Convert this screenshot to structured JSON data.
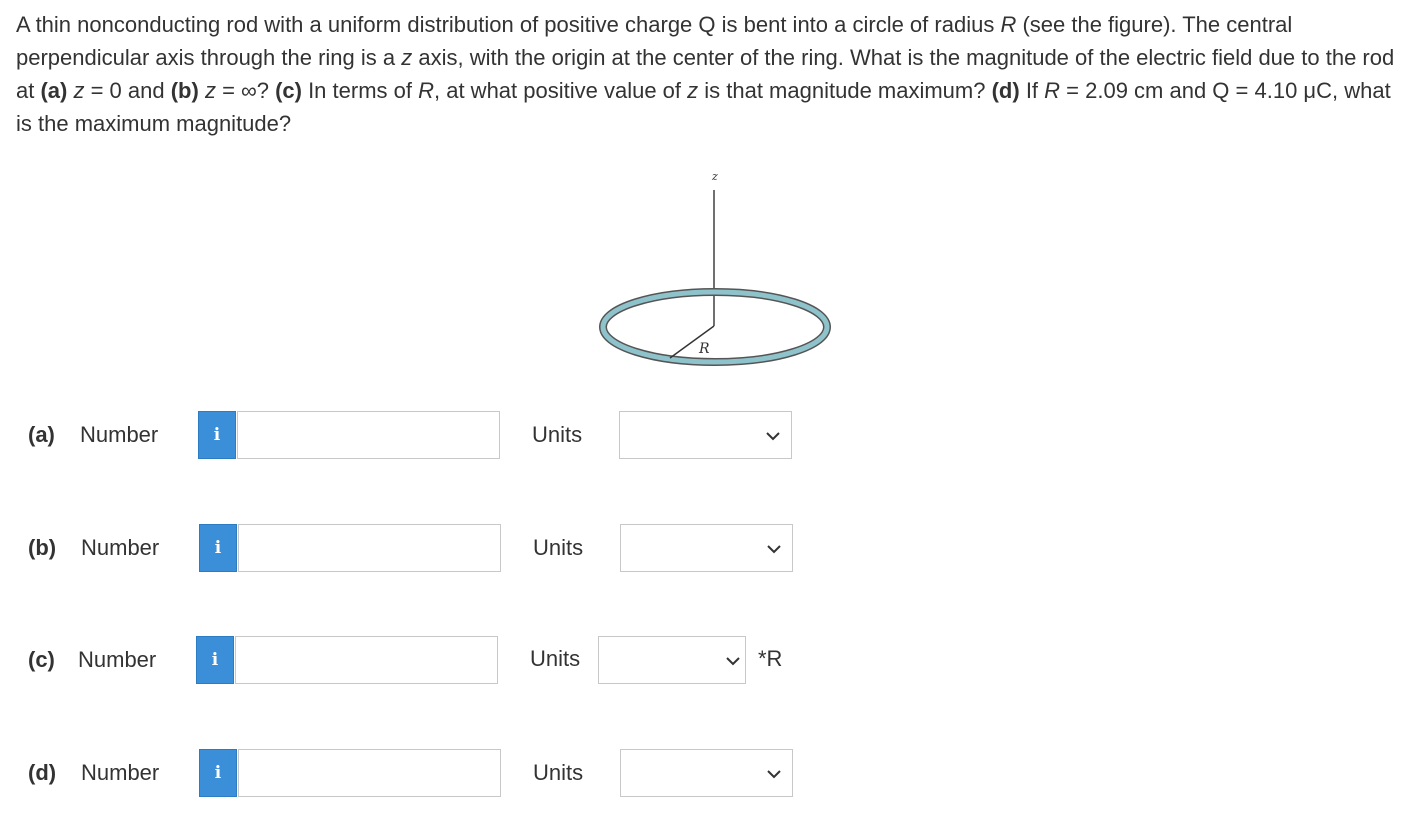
{
  "question": {
    "p1": "A thin nonconducting rod with a uniform distribution of positive charge Q is bent into a circle of radius ",
    "R1": "R",
    "p2": " (see the figure). The central perpendicular axis through the ring is a ",
    "z1": "z",
    "p3": " axis, with the origin at the center of the ring. What is the magnitude of the electric field due to the rod at ",
    "a": "(a)",
    "z2": "z",
    "p4": " = 0 and ",
    "b": "(b)",
    "z3": "z",
    "p5": " = ∞? ",
    "c": "(c)",
    "p6": " In terms of ",
    "R2": "R",
    "p7": ", at what positive value of ",
    "z4": "z",
    "p8": " is that magnitude maximum? ",
    "d": "(d)",
    "p9": " If ",
    "R3": "R",
    "p10": " = 2.09 cm and Q = 4.10 μC, what is the maximum magnitude?"
  },
  "figure": {
    "axis_label": "z",
    "radius_label": "R",
    "colors": {
      "ring": "#8fc3cc",
      "ring_stroke": "#555555",
      "axis": "#333333"
    }
  },
  "parts": [
    {
      "label": "(a)",
      "number_label": "Number",
      "info_icon": "i",
      "value": "",
      "units_label": "Units",
      "units_value": "",
      "suffix": ""
    },
    {
      "label": "(b)",
      "number_label": "Number",
      "info_icon": "i",
      "value": "",
      "units_label": "Units",
      "units_value": "",
      "suffix": ""
    },
    {
      "label": "(c)",
      "number_label": "Number",
      "info_icon": "i",
      "value": "",
      "units_label": "Units",
      "units_value": "",
      "suffix": "*R"
    },
    {
      "label": "(d)",
      "number_label": "Number",
      "info_icon": "i",
      "value": "",
      "units_label": "Units",
      "units_value": "",
      "suffix": ""
    }
  ],
  "colors": {
    "info_button": "#3a8fd8",
    "text": "#333333",
    "border": "#c8c8c8"
  }
}
